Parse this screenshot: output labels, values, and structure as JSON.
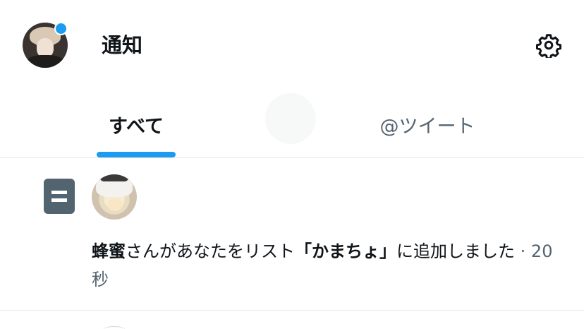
{
  "header": {
    "title": "通知",
    "avatar_icon": "user-avatar",
    "settings_icon": "gear-icon",
    "notification_dot_color": "#1d9bf0"
  },
  "tabs": [
    {
      "label": "すべて",
      "selected": true
    },
    {
      "label": "@ツイート",
      "selected": false
    }
  ],
  "accent_color": "#1d9bf0",
  "notification": {
    "type_icon": "list-icon",
    "actor": "蜂蜜",
    "text_middle": "さんがあなたをリスト",
    "list_name": "「かまちょ」",
    "text_end": "に追加しました",
    "separator": "·",
    "time": "20秒"
  }
}
